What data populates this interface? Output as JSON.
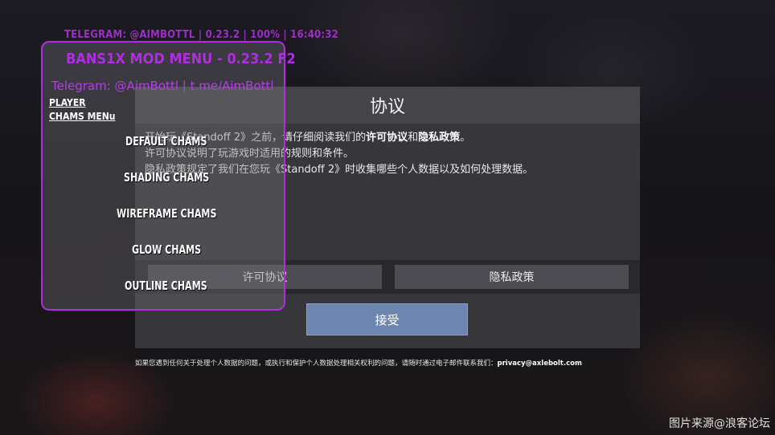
{
  "status_bar": {
    "text": "TELEGRAM: @AIMBOTTL | 0.23.2 | 100% | 16:40:32"
  },
  "dialog": {
    "title": "协议",
    "body": {
      "line1_prefix": "开始玩《Standoff 2》之前，请仔细阅读我们的",
      "line1_license": "许可协议",
      "line1_and": "和",
      "line1_privacy": "隐私政策",
      "line1_end": "。",
      "line2": "许可协议说明了玩游戏时适用的规则和条件。",
      "line3": "隐私政策规定了我们在您玩《Standoff 2》时收集哪些个人数据以及如何处理数据。"
    },
    "license_button": "许可协议",
    "privacy_button": "隐私政策",
    "accept_button": "接受"
  },
  "footer": {
    "text": "如果您遇到任何关于处理个人数据的问题，或执行和保护个人数据处理相关权利的问题，请随时通过电子邮件联系我们：",
    "email": "privacy@axlebolt.com"
  },
  "mod_menu": {
    "title": "BANS1X MOD MENU - 0.23.2 F2",
    "telegram": "Telegram: @AimBottl | t.me/AimBottl",
    "nav": {
      "player": "PLAYER",
      "chams_menu": "CHAMS MENu"
    },
    "chams": {
      "default": "DEFAULT CHAMS",
      "shading": "SHADING CHAMS",
      "wireframe": "WIREFRAME CHAMS",
      "glow": "GLOW CHAMS",
      "outline": "OUTLINE CHAMS"
    },
    "accent_color": "#b02ee0"
  },
  "watermark": "图片来源@浪客论坛"
}
